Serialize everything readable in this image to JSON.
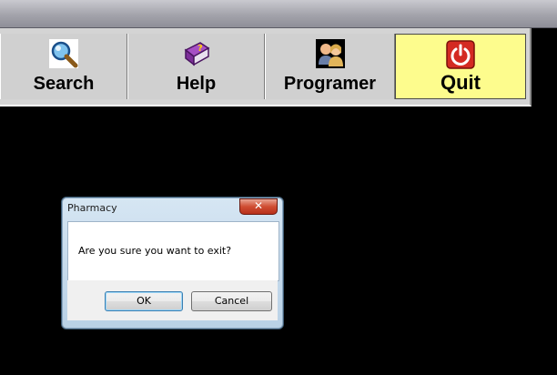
{
  "toolbar": {
    "buttons": [
      {
        "label": "Search",
        "icon": "magnifier-icon"
      },
      {
        "label": "Help",
        "icon": "help-book-icon"
      },
      {
        "label": "Programer",
        "icon": "users-icon"
      },
      {
        "label": "Quit",
        "icon": "power-icon"
      }
    ],
    "quit_highlight_color": "#fdfc8d"
  },
  "dialog": {
    "title": "Pharmacy",
    "close_label": "✕",
    "message": "Are you sure you want to exit?",
    "ok_label": "OK",
    "cancel_label": "Cancel"
  }
}
